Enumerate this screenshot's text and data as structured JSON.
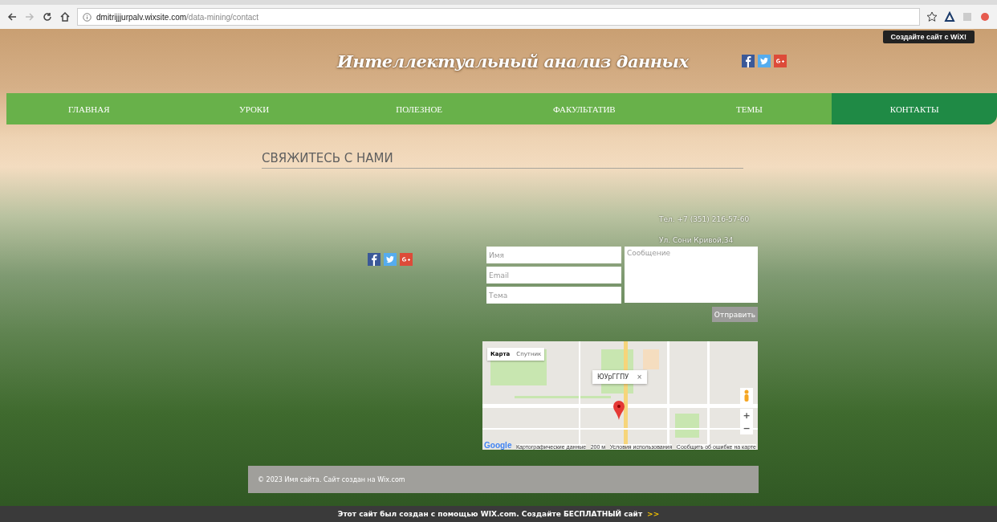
{
  "browser": {
    "url_host": "dmitrijjjurpalv.wixsite.com",
    "url_path": "/data-mining/contact",
    "wix_tooltip": "Создайте сайт с WiX!"
  },
  "header": {
    "title": "Интеллектуальный анализ данных"
  },
  "nav": [
    {
      "label": "ГЛАВНАЯ",
      "selected": false
    },
    {
      "label": "УРОКИ",
      "selected": false
    },
    {
      "label": "ПОЛЕЗНОЕ",
      "selected": false
    },
    {
      "label": "ФАКУЛЬТАТИВ",
      "selected": false
    },
    {
      "label": "ТЕМЫ",
      "selected": false
    },
    {
      "label": "КОНТАКТЫ",
      "selected": true
    }
  ],
  "contact": {
    "heading": "СВЯЖИТЕСЬ С НАМИ",
    "phone": "Тел. +7 (351) 216-57-60",
    "address": "Ул. Сони Кривой,34"
  },
  "form": {
    "fields": [
      {
        "placeholder": "Имя"
      },
      {
        "placeholder": "Email"
      },
      {
        "placeholder": "Тема"
      }
    ],
    "message": {
      "placeholder": "Сообщение"
    },
    "submit": "Отправить"
  },
  "map": {
    "types": [
      {
        "label": "Карта",
        "selected": true
      },
      {
        "label": "Спутник",
        "selected": false
      }
    ],
    "info": "ЮУрГГПУ",
    "close": "×",
    "zoom_in": "+",
    "zoom_out": "−",
    "logo": "Google",
    "attribution": [
      "Картографические данные",
      "200 м",
      "Условия использования",
      "Сообщить об ошибке на карте"
    ]
  },
  "footer": {
    "text": "© 2023 Имя сайта. Сайт создан на Wix.com"
  },
  "banner": {
    "text": "Этот сайт был создан с помощью WIX.com. Создайте БЕСПЛАТНЫЙ сайт",
    "arrows": ">>"
  }
}
